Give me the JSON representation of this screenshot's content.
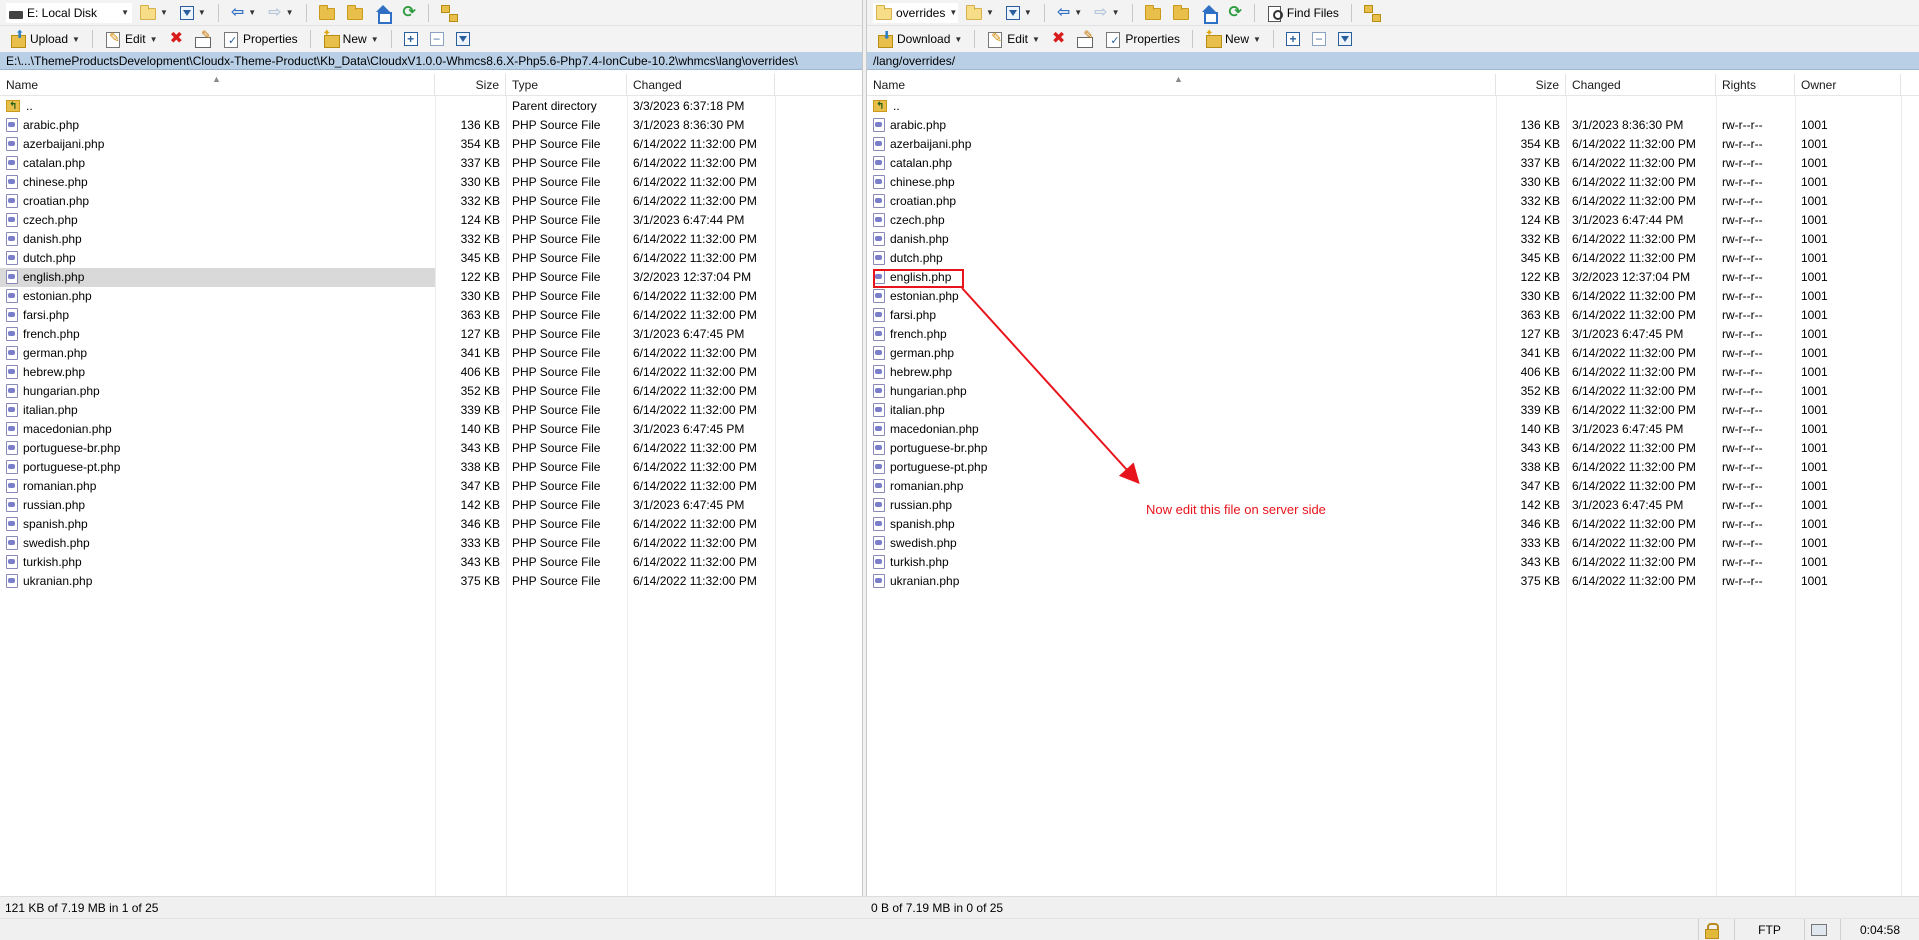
{
  "left_pane": {
    "drive_label": "E: Local Disk",
    "toolbar": {
      "upload_label": "Upload",
      "edit_label": "Edit",
      "properties_label": "Properties",
      "new_label": "New"
    },
    "path": "E:\\...\\ThemeProductsDevelopment\\Cloudx-Theme-Product\\Kb_Data\\CloudxV1.0.0-Whmcs8.6.X-Php5.6-Php7.4-IonCube-10.2\\whmcs\\lang\\overrides\\",
    "columns": {
      "name": "Name",
      "size": "Size",
      "type": "Type",
      "changed": "Changed"
    },
    "parent": {
      "name": "..",
      "type": "Parent directory",
      "changed": "3/3/2023  6:37:18 PM"
    },
    "files": [
      {
        "name": "arabic.php",
        "size": "136 KB",
        "type": "PHP Source File",
        "changed": "3/1/2023  8:36:30 PM"
      },
      {
        "name": "azerbaijani.php",
        "size": "354 KB",
        "type": "PHP Source File",
        "changed": "6/14/2022  11:32:00 PM"
      },
      {
        "name": "catalan.php",
        "size": "337 KB",
        "type": "PHP Source File",
        "changed": "6/14/2022  11:32:00 PM"
      },
      {
        "name": "chinese.php",
        "size": "330 KB",
        "type": "PHP Source File",
        "changed": "6/14/2022  11:32:00 PM"
      },
      {
        "name": "croatian.php",
        "size": "332 KB",
        "type": "PHP Source File",
        "changed": "6/14/2022  11:32:00 PM"
      },
      {
        "name": "czech.php",
        "size": "124 KB",
        "type": "PHP Source File",
        "changed": "3/1/2023  6:47:44 PM"
      },
      {
        "name": "danish.php",
        "size": "332 KB",
        "type": "PHP Source File",
        "changed": "6/14/2022  11:32:00 PM"
      },
      {
        "name": "dutch.php",
        "size": "345 KB",
        "type": "PHP Source File",
        "changed": "6/14/2022  11:32:00 PM"
      },
      {
        "name": "english.php",
        "size": "122 KB",
        "type": "PHP Source File",
        "changed": "3/2/2023  12:37:04 PM",
        "selected": true
      },
      {
        "name": "estonian.php",
        "size": "330 KB",
        "type": "PHP Source File",
        "changed": "6/14/2022  11:32:00 PM"
      },
      {
        "name": "farsi.php",
        "size": "363 KB",
        "type": "PHP Source File",
        "changed": "6/14/2022  11:32:00 PM"
      },
      {
        "name": "french.php",
        "size": "127 KB",
        "type": "PHP Source File",
        "changed": "3/1/2023  6:47:45 PM"
      },
      {
        "name": "german.php",
        "size": "341 KB",
        "type": "PHP Source File",
        "changed": "6/14/2022  11:32:00 PM"
      },
      {
        "name": "hebrew.php",
        "size": "406 KB",
        "type": "PHP Source File",
        "changed": "6/14/2022  11:32:00 PM"
      },
      {
        "name": "hungarian.php",
        "size": "352 KB",
        "type": "PHP Source File",
        "changed": "6/14/2022  11:32:00 PM"
      },
      {
        "name": "italian.php",
        "size": "339 KB",
        "type": "PHP Source File",
        "changed": "6/14/2022  11:32:00 PM"
      },
      {
        "name": "macedonian.php",
        "size": "140 KB",
        "type": "PHP Source File",
        "changed": "3/1/2023  6:47:45 PM"
      },
      {
        "name": "portuguese-br.php",
        "size": "343 KB",
        "type": "PHP Source File",
        "changed": "6/14/2022  11:32:00 PM"
      },
      {
        "name": "portuguese-pt.php",
        "size": "338 KB",
        "type": "PHP Source File",
        "changed": "6/14/2022  11:32:00 PM"
      },
      {
        "name": "romanian.php",
        "size": "347 KB",
        "type": "PHP Source File",
        "changed": "6/14/2022  11:32:00 PM"
      },
      {
        "name": "russian.php",
        "size": "142 KB",
        "type": "PHP Source File",
        "changed": "3/1/2023  6:47:45 PM"
      },
      {
        "name": "spanish.php",
        "size": "346 KB",
        "type": "PHP Source File",
        "changed": "6/14/2022  11:32:00 PM"
      },
      {
        "name": "swedish.php",
        "size": "333 KB",
        "type": "PHP Source File",
        "changed": "6/14/2022  11:32:00 PM"
      },
      {
        "name": "turkish.php",
        "size": "343 KB",
        "type": "PHP Source File",
        "changed": "6/14/2022  11:32:00 PM"
      },
      {
        "name": "ukranian.php",
        "size": "375 KB",
        "type": "PHP Source File",
        "changed": "6/14/2022  11:32:00 PM"
      }
    ],
    "status": "121 KB of 7.19 MB in 1 of 25"
  },
  "right_pane": {
    "dir_label": "overrides",
    "toolbar": {
      "find_files_label": "Find Files",
      "download_label": "Download",
      "edit_label": "Edit",
      "properties_label": "Properties",
      "new_label": "New"
    },
    "path": "/lang/overrides/",
    "columns": {
      "name": "Name",
      "size": "Size",
      "changed": "Changed",
      "rights": "Rights",
      "owner": "Owner"
    },
    "parent": {
      "name": ".."
    },
    "files": [
      {
        "name": "arabic.php",
        "size": "136 KB",
        "changed": "3/1/2023 8:36:30 PM",
        "rights": "rw-r--r--",
        "owner": "1001"
      },
      {
        "name": "azerbaijani.php",
        "size": "354 KB",
        "changed": "6/14/2022 11:32:00 PM",
        "rights": "rw-r--r--",
        "owner": "1001"
      },
      {
        "name": "catalan.php",
        "size": "337 KB",
        "changed": "6/14/2022 11:32:00 PM",
        "rights": "rw-r--r--",
        "owner": "1001"
      },
      {
        "name": "chinese.php",
        "size": "330 KB",
        "changed": "6/14/2022 11:32:00 PM",
        "rights": "rw-r--r--",
        "owner": "1001"
      },
      {
        "name": "croatian.php",
        "size": "332 KB",
        "changed": "6/14/2022 11:32:00 PM",
        "rights": "rw-r--r--",
        "owner": "1001"
      },
      {
        "name": "czech.php",
        "size": "124 KB",
        "changed": "3/1/2023 6:47:44 PM",
        "rights": "rw-r--r--",
        "owner": "1001"
      },
      {
        "name": "danish.php",
        "size": "332 KB",
        "changed": "6/14/2022 11:32:00 PM",
        "rights": "rw-r--r--",
        "owner": "1001"
      },
      {
        "name": "dutch.php",
        "size": "345 KB",
        "changed": "6/14/2022 11:32:00 PM",
        "rights": "rw-r--r--",
        "owner": "1001"
      },
      {
        "name": "english.php",
        "size": "122 KB",
        "changed": "3/2/2023 12:37:04 PM",
        "rights": "rw-r--r--",
        "owner": "1001",
        "highlighted": true
      },
      {
        "name": "estonian.php",
        "size": "330 KB",
        "changed": "6/14/2022 11:32:00 PM",
        "rights": "rw-r--r--",
        "owner": "1001"
      },
      {
        "name": "farsi.php",
        "size": "363 KB",
        "changed": "6/14/2022 11:32:00 PM",
        "rights": "rw-r--r--",
        "owner": "1001"
      },
      {
        "name": "french.php",
        "size": "127 KB",
        "changed": "3/1/2023 6:47:45 PM",
        "rights": "rw-r--r--",
        "owner": "1001"
      },
      {
        "name": "german.php",
        "size": "341 KB",
        "changed": "6/14/2022 11:32:00 PM",
        "rights": "rw-r--r--",
        "owner": "1001"
      },
      {
        "name": "hebrew.php",
        "size": "406 KB",
        "changed": "6/14/2022 11:32:00 PM",
        "rights": "rw-r--r--",
        "owner": "1001"
      },
      {
        "name": "hungarian.php",
        "size": "352 KB",
        "changed": "6/14/2022 11:32:00 PM",
        "rights": "rw-r--r--",
        "owner": "1001"
      },
      {
        "name": "italian.php",
        "size": "339 KB",
        "changed": "6/14/2022 11:32:00 PM",
        "rights": "rw-r--r--",
        "owner": "1001"
      },
      {
        "name": "macedonian.php",
        "size": "140 KB",
        "changed": "3/1/2023 6:47:45 PM",
        "rights": "rw-r--r--",
        "owner": "1001"
      },
      {
        "name": "portuguese-br.php",
        "size": "343 KB",
        "changed": "6/14/2022 11:32:00 PM",
        "rights": "rw-r--r--",
        "owner": "1001"
      },
      {
        "name": "portuguese-pt.php",
        "size": "338 KB",
        "changed": "6/14/2022 11:32:00 PM",
        "rights": "rw-r--r--",
        "owner": "1001"
      },
      {
        "name": "romanian.php",
        "size": "347 KB",
        "changed": "6/14/2022 11:32:00 PM",
        "rights": "rw-r--r--",
        "owner": "1001"
      },
      {
        "name": "russian.php",
        "size": "142 KB",
        "changed": "3/1/2023 6:47:45 PM",
        "rights": "rw-r--r--",
        "owner": "1001"
      },
      {
        "name": "spanish.php",
        "size": "346 KB",
        "changed": "6/14/2022 11:32:00 PM",
        "rights": "rw-r--r--",
        "owner": "1001"
      },
      {
        "name": "swedish.php",
        "size": "333 KB",
        "changed": "6/14/2022 11:32:00 PM",
        "rights": "rw-r--r--",
        "owner": "1001"
      },
      {
        "name": "turkish.php",
        "size": "343 KB",
        "changed": "6/14/2022 11:32:00 PM",
        "rights": "rw-r--r--",
        "owner": "1001"
      },
      {
        "name": "ukranian.php",
        "size": "375 KB",
        "changed": "6/14/2022 11:32:00 PM",
        "rights": "rw-r--r--",
        "owner": "1001"
      }
    ],
    "status": "0 B of 7.19 MB in 0 of 25"
  },
  "bottom_bar": {
    "protocol": "FTP",
    "elapsed": "0:04:58"
  },
  "annotation": {
    "text": "Now edit this file on server side",
    "color": "#e8141c"
  },
  "colors": {
    "path_bar": "#b9cfe6",
    "selection": "#d9d9d9",
    "annotation": "#e8141c"
  }
}
